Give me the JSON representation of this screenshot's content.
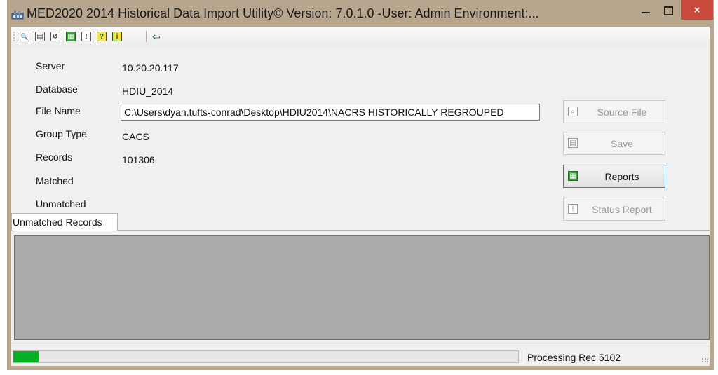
{
  "window": {
    "title": "MED2020 2014 Historical Data Import Utility©  Version: 7.0.1.0  -User: Admin  Environment:...",
    "close_label": "×"
  },
  "toolbar": {
    "buttons": [
      {
        "icon": "magnifier-icon",
        "glyph": "🔍"
      },
      {
        "icon": "save-disk-icon",
        "glyph": "▤"
      },
      {
        "icon": "refresh-icon",
        "glyph": "↺"
      },
      {
        "icon": "report-icon",
        "glyph": "▦"
      },
      {
        "icon": "status-report-icon",
        "glyph": "!"
      },
      {
        "icon": "help-icon",
        "glyph": "?"
      },
      {
        "icon": "info-icon",
        "glyph": "i"
      },
      {
        "icon": "exit-door-icon",
        "glyph": "⇦"
      }
    ]
  },
  "form": {
    "server_label": "Server",
    "server_value": "10.20.20.117",
    "database_label": "Database",
    "database_value": "HDIU_2014",
    "filename_label": "File Name",
    "filename_value": "C:\\Users\\dyan.tufts-conrad\\Desktop\\HDIU2014\\NACRS HISTORICALLY REGROUPED",
    "group_type_label": "Group Type",
    "group_type_value": "CACS",
    "records_label": "Records",
    "records_value": "101306",
    "matched_label": "Matched",
    "matched_value": "",
    "unmatched_label": "Unmatched",
    "unmatched_value": ""
  },
  "side_buttons": {
    "source_file": "Source File",
    "save": "Save",
    "reports": "Reports",
    "status_report": "Status Report"
  },
  "tabs": {
    "unmatched_records": "Unmatched Records"
  },
  "status": {
    "progress_fraction": 0.05,
    "text": "Processing Rec  5102"
  },
  "colors": {
    "title_bar": "#b9a68f",
    "close_button": "#c94a3c",
    "progress_fill": "#06b025",
    "grid_background": "#ababab",
    "active_border": "#3c7fb1"
  }
}
